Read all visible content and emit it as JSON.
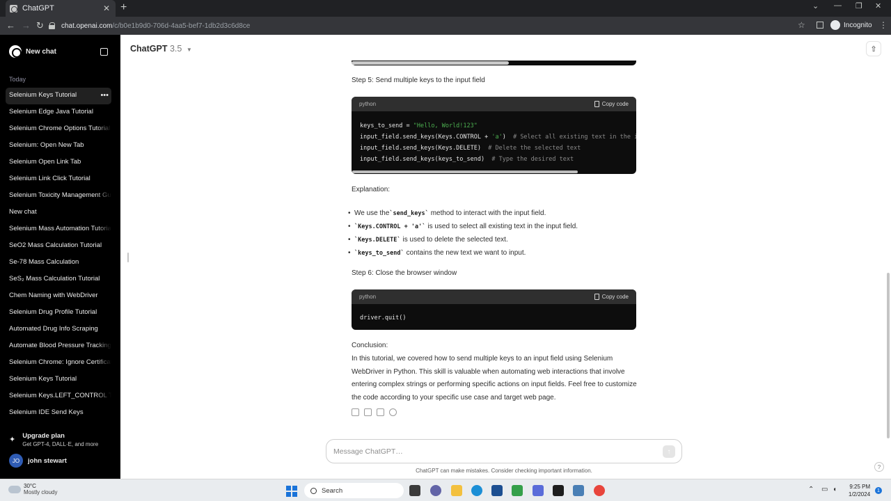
{
  "browser": {
    "tab_title": "ChatGPT",
    "url_host": "chat.openai.com",
    "url_path": "/c/b0e1b9d0-706d-4aa5-bef7-1db2d3c6d8ce",
    "profile_label": "Incognito"
  },
  "sidebar": {
    "new_chat_label": "New chat",
    "section_label": "Today",
    "items": [
      "Selenium Keys Tutorial",
      "Selenium Edge Java Tutorial",
      "Selenium Chrome Options Tutorial",
      "Selenium: Open New Tab",
      "Selenium Open Link Tab",
      "Selenium Link Click Tutorial",
      "Selenium Toxicity Management Guide",
      "New chat",
      "Selenium Mass Automation Tutorial",
      "SeO2 Mass Calculation Tutorial",
      "Se-78 Mass Calculation",
      "SeS₂ Mass Calculation Tutorial",
      "Chem Naming with WebDriver",
      "Selenium Drug Profile Tutorial",
      "Automated Drug Info Scraping",
      "Automate Blood Pressure Tracking",
      "Selenium Chrome: Ignore Certificate",
      "Selenium Keys Tutorial",
      "Selenium Keys.LEFT_CONTROL Tutorial",
      "Selenium IDE Send Keys"
    ],
    "upgrade_title": "Upgrade plan",
    "upgrade_subtitle": "Get GPT-4, DALL·E, and more",
    "user_initials": "JO",
    "user_name": "john stewart"
  },
  "header": {
    "model_name": "ChatGPT",
    "model_version": "3.5"
  },
  "content": {
    "step5_title": "Step 5: Send multiple keys to the input field",
    "code1_lang": "python",
    "copy_label": "Copy code",
    "code1_lines": [
      {
        "code": "keys_to_send = ",
        "str": "\"Hello, World!123\"",
        "comment": ""
      },
      {
        "code": "input_field.send_keys(Keys.CONTROL + ",
        "str": "'a'",
        "code2": ")  ",
        "comment": "# Select all existing text in the input field"
      },
      {
        "code": "input_field.send_keys(Keys.DELETE)  ",
        "str": "",
        "comment": "# Delete the selected text"
      },
      {
        "code": "input_field.send_keys(keys_to_send)  ",
        "str": "",
        "comment": "# Type the desired text"
      }
    ],
    "explanation_label": "Explanation:",
    "bullets": [
      {
        "pre": "We use the ",
        "code": "`send_keys`",
        "post": " method to interact with the input field."
      },
      {
        "pre": "",
        "code": "`Keys.CONTROL + 'a'`",
        "post": " is used to select all existing text in the input field."
      },
      {
        "pre": "",
        "code": "`Keys.DELETE`",
        "post": " is used to delete the selected text."
      },
      {
        "pre": "",
        "code": "`keys_to_send`",
        "post": " contains the new text we want to input."
      }
    ],
    "step6_title": "Step 6: Close the browser window",
    "code2_lang": "python",
    "code2_text": "driver.quit()",
    "conclusion_label": "Conclusion:",
    "conclusion_text": "In this tutorial, we covered how to send multiple keys to an input field using Selenium WebDriver in Python. This skill is valuable when automating web interactions that involve entering complex strings or performing specific actions on input fields. Feel free to customize the code according to your specific use case and target web page."
  },
  "composer": {
    "placeholder": "Message ChatGPT…",
    "disclaimer": "ChatGPT can make mistakes. Consider checking important information."
  },
  "taskbar": {
    "temperature": "30°C",
    "weather": "Mostly cloudy",
    "search_label": "Search",
    "time": "9:25 PM",
    "date": "1/2/2024",
    "notification_count": "1"
  },
  "colors": {
    "sidebar_bg": "#000000",
    "code_bg": "#0d0d0d",
    "string_green": "#4caf50",
    "accent_blue": "#1a73d9"
  }
}
